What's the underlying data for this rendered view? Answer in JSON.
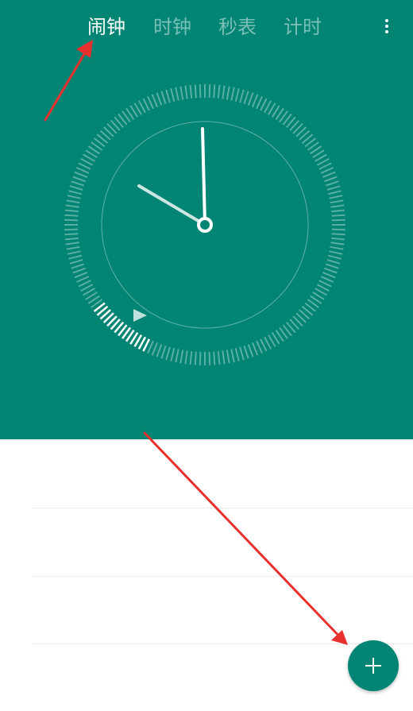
{
  "tabs": [
    {
      "label": "闹钟",
      "active": true
    },
    {
      "label": "时钟",
      "active": false
    },
    {
      "label": "秒表",
      "active": false
    },
    {
      "label": "计时",
      "active": false
    }
  ],
  "icons": {
    "menu": "more-vert-icon",
    "add": "plus-icon"
  },
  "colors": {
    "primary": "#008473",
    "annotation_arrow": "#e8312f"
  },
  "alarm_list": {
    "item_count_visible": 0
  }
}
